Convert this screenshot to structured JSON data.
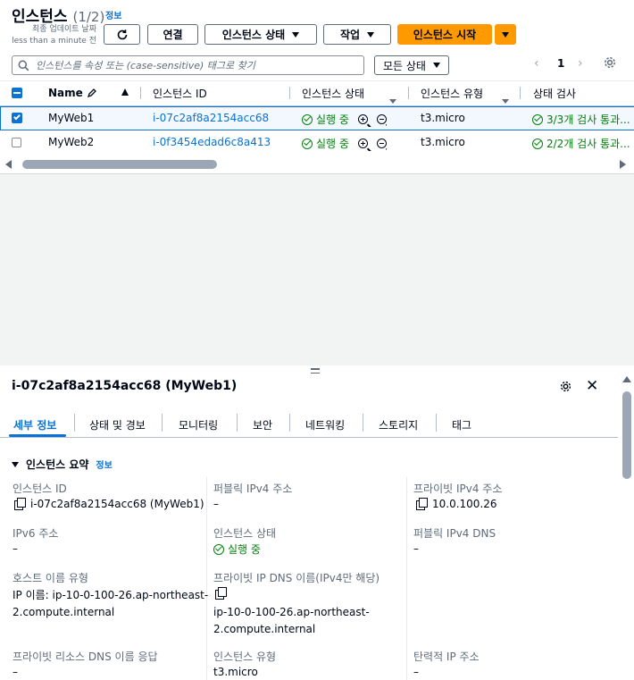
{
  "header": {
    "title": "인스턴스",
    "count": "(1/2)",
    "info": "정보",
    "last_updated_line1": "최종 업데이트 날짜",
    "last_updated_line2": "less than a minute 전",
    "connect_label": "연결",
    "instance_state_label": "인스턴스 상태",
    "actions_label": "작업",
    "launch_label": "인스턴스 시작"
  },
  "search": {
    "placeholder": "인스턴스를 속성 또는 (case-sensitive) 태그로 찾기",
    "state_filter": "모든 상태",
    "page": "1"
  },
  "table": {
    "columns": [
      "Name",
      "인스턴스 ID",
      "인스턴스 상태",
      "인스턴스 유형",
      "상태 검사"
    ],
    "rows": [
      {
        "name": "MyWeb1",
        "id": "i-07c2af8a2154acc68",
        "state": "실행 중",
        "type": "t3.micro",
        "check": "3/3개 검사 통과...",
        "selected": true
      },
      {
        "name": "MyWeb2",
        "id": "i-0f3454edad6c8a413",
        "state": "실행 중",
        "type": "t3.micro",
        "check": "2/2개 검사 통과...",
        "selected": false
      }
    ]
  },
  "detail": {
    "title": "i-07c2af8a2154acc68 (MyWeb1)",
    "tabs": [
      "세부 정보",
      "상태 및 경보",
      "모니터링",
      "보안",
      "네트워킹",
      "스토리지",
      "태그"
    ],
    "section_title": "인스턴스 요약",
    "section_info": "정보",
    "fields": {
      "instance_id_label": "인스턴스 ID",
      "instance_id_value": "i-07c2af8a2154acc68 (MyWeb1)",
      "public_ipv4_label": "퍼블릭 IPv4 주소",
      "public_ipv4_value": "–",
      "private_ipv4_label": "프라이빗 IPv4 주소",
      "private_ipv4_value": "10.0.100.26",
      "ipv6_label": "IPv6 주소",
      "ipv6_value": "–",
      "instance_state_label": "인스턴스 상태",
      "instance_state_value": "실행 중",
      "public_dns_label": "퍼블릭 IPv4 DNS",
      "public_dns_value": "–",
      "hostname_type_label": "호스트 이름 유형",
      "hostname_type_value_1": "IP 이름: ip-10-0-100-26.ap-northeast-",
      "hostname_type_value_2": "2.compute.internal",
      "private_dns_label": "프라이빗 IP DNS 이름(IPv4만 해당)",
      "private_dns_value_1": "ip-10-0-100-26.ap-northeast-",
      "private_dns_value_2": "2.compute.internal",
      "resource_dns_label": "프라이빗 리소스 DNS 이름 응답",
      "resource_dns_value": "–",
      "instance_type_label": "인스턴스 유형",
      "instance_type_value": "t3.micro",
      "elastic_ip_label": "탄력적 IP 주소",
      "elastic_ip_value": "–"
    }
  },
  "colors": {
    "accent": "#ff9900",
    "link": "#0972d3",
    "success": "#037f0c"
  }
}
